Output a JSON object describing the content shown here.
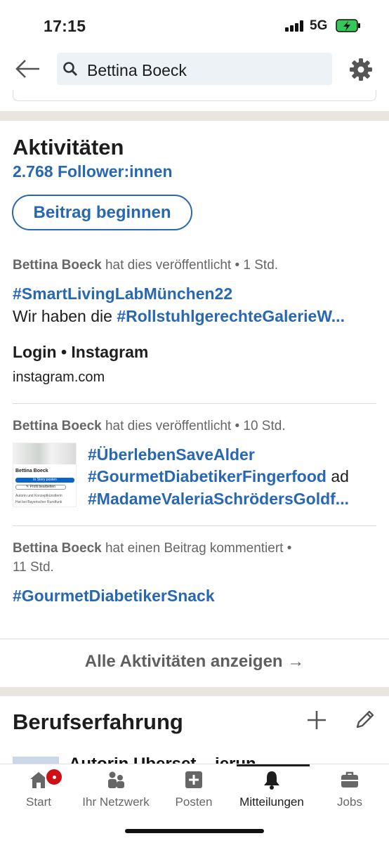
{
  "status": {
    "time": "17:15",
    "network": "5G"
  },
  "search": {
    "query": "Bettina Boeck"
  },
  "activity": {
    "title": "Aktivitäten",
    "followers": "2.768 Follower:innen",
    "start_post_label": "Beitrag beginnen",
    "posts": [
      {
        "author": "Bettina Boeck",
        "action": " hat dies veröffentlicht • 1 Std.",
        "tag1": "#SmartLivingLabMünchen22",
        "text_prefix": "Wir haben die ",
        "tag2": "#RollstuhlgerechteGalerieW...",
        "link_title": "Login • Instagram",
        "link_url": "instagram.com"
      },
      {
        "author": "Bettina Boeck",
        "action": " hat dies veröffentlicht • 10 Std.",
        "thumb_name": "Bettina Boeck",
        "thumb_story": "In Story posten",
        "thumb_profile": "✎ Profil bearbeiten",
        "thumb_line1": "Autorin und Konzeptkünstlerin",
        "thumb_line2": "Hat bei Bayerischer Rundfunk",
        "line1": "#ÜberlebenSaveAlder",
        "line2_tag": "#GourmetDiabetikerFingerfood",
        "line2_suffix": " ad",
        "line3": "#MadameValeriaSchrödersGoldf..."
      },
      {
        "author": "Bettina Boeck",
        "action": " hat einen Beitrag kommentiert •",
        "time": "11 Std.",
        "tag": "#GourmetDiabetikerSnack"
      }
    ],
    "show_all": "Alle Aktivitäten anzeigen →"
  },
  "experience": {
    "title": "Berufserfahrung",
    "peek": "Autorin Überset... ierun"
  },
  "nav": {
    "items": [
      {
        "label": "Start"
      },
      {
        "label": "Ihr Netzwerk"
      },
      {
        "label": "Posten"
      },
      {
        "label": "Mitteilungen"
      },
      {
        "label": "Jobs"
      }
    ]
  },
  "colors": {
    "accent": "#2867b2",
    "badge": "#cc1016",
    "separator": "#e9e6e0"
  }
}
